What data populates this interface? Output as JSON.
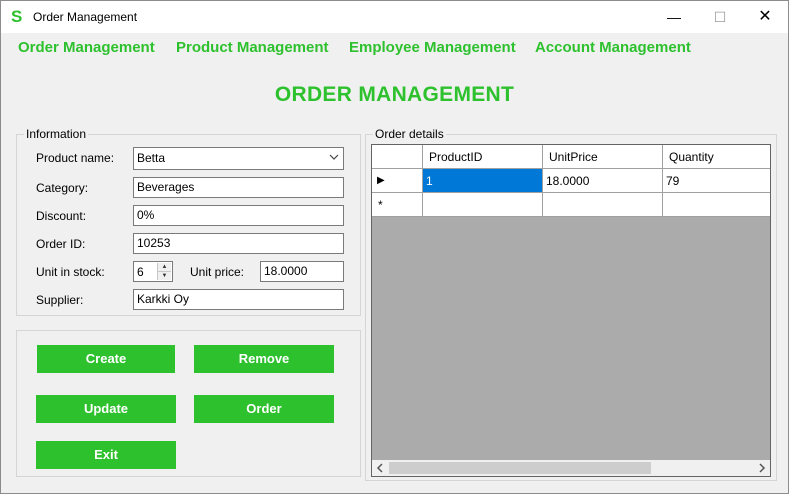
{
  "window": {
    "title": "Order Management",
    "icon_glyph": "S",
    "controls": {
      "minimize": "—",
      "maximize": "☐",
      "close": "✕"
    }
  },
  "menu": {
    "items": [
      {
        "label": "Order Management"
      },
      {
        "label": "Product Management"
      },
      {
        "label": "Employee Management"
      },
      {
        "label": "Account Management"
      }
    ]
  },
  "page_heading": "ORDER MANAGEMENT",
  "information": {
    "legend": "Information",
    "product_name": {
      "label": "Product name:",
      "value": "Betta"
    },
    "category": {
      "label": "Category:",
      "value": "Beverages"
    },
    "discount": {
      "label": "Discount:",
      "value": "0%"
    },
    "order_id": {
      "label": "Order ID:",
      "value": "10253"
    },
    "unit_in_stock": {
      "label": "Unit in stock:",
      "value": "6"
    },
    "unit_price": {
      "label": "Unit price:",
      "value": "18.0000"
    },
    "supplier": {
      "label": "Supplier:",
      "value": "Karkki Oy"
    }
  },
  "actions": {
    "create": "Create",
    "remove": "Remove",
    "update": "Update",
    "order": "Order",
    "exit": "Exit"
  },
  "order_details": {
    "legend": "Order details",
    "columns": [
      "ProductID",
      "UnitPrice",
      "Quantity"
    ],
    "rows": [
      {
        "indicator": "▶",
        "cells": [
          "1",
          "18.0000",
          "79"
        ]
      }
    ],
    "new_row_indicator": "*"
  },
  "colors": {
    "accent_green": "#2ec12e",
    "selection_blue": "#0078d7",
    "window_bg": "#f0f0f0"
  },
  "icons": {
    "app": "app-s-icon",
    "combo_arrow": "chevron-down-icon",
    "spin_up": "caret-up-icon",
    "spin_down": "caret-down-icon",
    "row_current": "row-pointer-icon",
    "scroll_left": "chevron-left-icon",
    "scroll_right": "chevron-right-icon"
  }
}
